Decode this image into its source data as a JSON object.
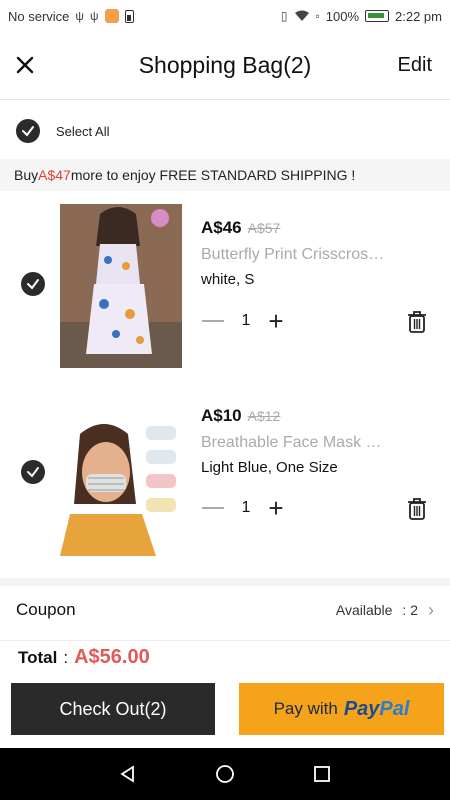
{
  "status_bar": {
    "carrier": "No service",
    "battery": "100%",
    "time": "2:22 pm"
  },
  "header": {
    "title": "Shopping Bag(2)",
    "edit_label": "Edit"
  },
  "select_all": {
    "label": "Select All",
    "checked": true
  },
  "shipping_banner": {
    "prefix": "Buy ",
    "amount": "A$47",
    "suffix": " more to enjoy FREE STANDARD SHIPPING !"
  },
  "items": [
    {
      "price": "A$46",
      "original_price": "A$57",
      "name": "Butterfly Print Crisscross Top & Pants Set",
      "variant": "white, S",
      "quantity": "1",
      "checked": true
    },
    {
      "price": "A$10",
      "original_price": "A$12",
      "name": "Breathable Face Mask With Clear Window",
      "variant": "Light Blue, One Size",
      "quantity": "1",
      "checked": true
    }
  ],
  "coupon": {
    "label": "Coupon",
    "available_label": "Available",
    "count": ": 2"
  },
  "total": {
    "label": "Total",
    "separator": ":",
    "value": "A$56.00"
  },
  "buttons": {
    "checkout": "Check Out(2)",
    "paypal_prefix": "Pay with",
    "paypal_brand_a": "Pay",
    "paypal_brand_b": "Pal"
  },
  "colors": {
    "accent_red": "#e0403a",
    "total_red": "#e05a5a",
    "checkout_bg": "#2a2a2a",
    "paypal_bg": "#f5a31a"
  }
}
